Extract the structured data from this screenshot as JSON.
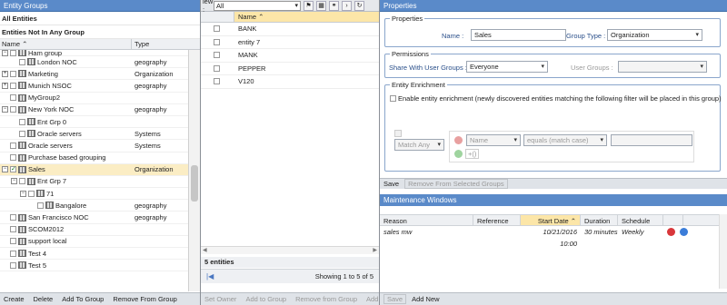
{
  "left": {
    "header": "Entity Groups",
    "all_entities": "All Entities",
    "not_in_group": "Entities Not In Any Group",
    "col_name": "Name",
    "col_type": "Type",
    "rows": [
      {
        "name": "Ham group",
        "type": ""
      },
      {
        "name": "London NOC",
        "type": "geography"
      },
      {
        "name": "Marketing",
        "type": "Organization"
      },
      {
        "name": "Munich NSOC",
        "type": "geography"
      },
      {
        "name": "MyGroup2",
        "type": ""
      },
      {
        "name": "New York NOC",
        "type": "geography"
      },
      {
        "name": "Ent Grp 0",
        "type": ""
      },
      {
        "name": "Oracle servers",
        "type": "Systems"
      },
      {
        "name": "Oracle servers",
        "type": "Systems"
      },
      {
        "name": "Purchase based grouping",
        "type": ""
      },
      {
        "name": "Sales",
        "type": "Organization"
      },
      {
        "name": "Ent Grp 7",
        "type": ""
      },
      {
        "name": "71",
        "type": ""
      },
      {
        "name": "Bangalore",
        "type": "geography"
      },
      {
        "name": "San Francisco NOC",
        "type": "geography"
      },
      {
        "name": "SCOM2012",
        "type": ""
      },
      {
        "name": "support local",
        "type": ""
      },
      {
        "name": "Test 4",
        "type": ""
      },
      {
        "name": "Test 5",
        "type": ""
      }
    ],
    "buttons": {
      "create": "Create",
      "delete": "Delete",
      "add_to_group": "Add To Group",
      "remove_from_group": "Remove From Group"
    }
  },
  "mid": {
    "view_label": "iew :",
    "view_value": "All",
    "col_name": "Name",
    "rows": [
      "BANK",
      "entity 7",
      "MANK",
      "PEPPER",
      "V120"
    ],
    "count": "5 entities",
    "showing": "Showing 1 to 5 of 5",
    "buttons": {
      "set_owner": "Set Owner",
      "add_to_group": "Add to Group",
      "remove_from_group": "Remove from Group",
      "add": "Add"
    }
  },
  "right": {
    "header": "Properties",
    "properties_legend": "Properties",
    "name_label": "Name :",
    "name_value": "Sales",
    "group_type_label": "Group Type :",
    "group_type_value": "Organization",
    "permissions_legend": "Permissions",
    "share_label": "Share With User Groups :",
    "share_value": "Everyone",
    "user_groups_label": "User Groups :",
    "enrichment_legend": "Entity Enrichment",
    "enrichment_text": "Enable entity enrichment (newly discovered entities matching the following filter will be placed in this group)",
    "match_value": "Match Any",
    "field_value": "Name",
    "op_value": "equals (match case)",
    "add_group_label": "+()",
    "save": "Save",
    "remove_selected": "Remove From Selected Groups",
    "mw_header": "Maintenance Windows",
    "mw_cols": [
      "Reason",
      "Reference",
      "Start Date",
      "Duration",
      "Schedule"
    ],
    "mw_rows": [
      {
        "reason": "sales mw",
        "reference": "",
        "start": "10/21/2016 10:00",
        "duration": "30 minutes",
        "schedule": "Weekly"
      }
    ],
    "mw_save": "Save",
    "mw_add": "Add New"
  }
}
